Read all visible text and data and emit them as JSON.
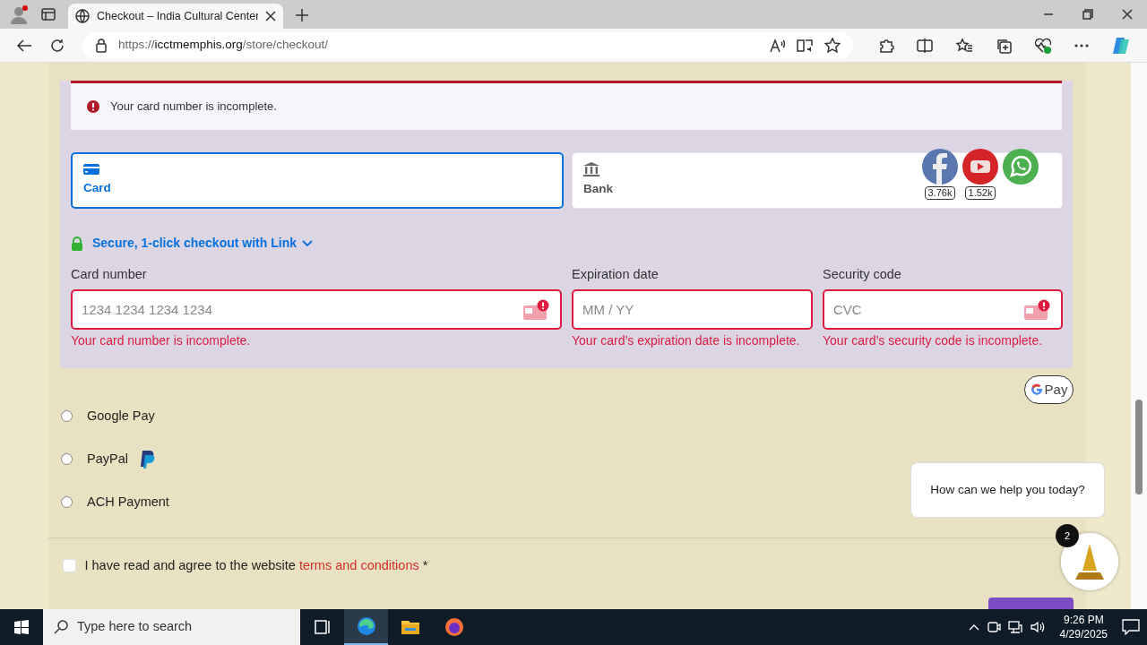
{
  "browser": {
    "tabs": [
      {
        "title": "Checkout – India Cultural Center",
        "selected": true
      }
    ],
    "url": {
      "scheme": "https://",
      "domain": "icctmemphis.org",
      "path": "/store/checkout/"
    }
  },
  "alert": {
    "text": "Your card number is incomplete."
  },
  "payment_tabs": [
    {
      "label": "Card",
      "kind": "card",
      "selected": true
    },
    {
      "label": "Bank",
      "kind": "bank",
      "selected": false
    }
  ],
  "social": [
    {
      "kind": "facebook",
      "count": "3.76k"
    },
    {
      "kind": "youtube",
      "count": "1.52k"
    },
    {
      "kind": "whatsapp"
    }
  ],
  "link_checkout": "Secure, 1-click checkout with Link",
  "fields": [
    {
      "label": "Card number",
      "placeholder": "1234 1234 1234 1234",
      "error": "Your card number is incomplete.",
      "kind": "card"
    },
    {
      "label": "Expiration date",
      "placeholder": "MM / YY",
      "error": "Your card’s expiration date is incomplete.",
      "kind": "expiry"
    },
    {
      "label": "Security code",
      "placeholder": "CVC",
      "error": "Your card’s security code is incomplete.",
      "kind": "cvc"
    }
  ],
  "payment_options": [
    {
      "label": "Google Pay",
      "kind": "googlepay",
      "selected": false,
      "badge": "Pay"
    },
    {
      "label": "PayPal",
      "kind": "paypal",
      "selected": false
    },
    {
      "label": "ACH Payment",
      "kind": "ach",
      "selected": false
    }
  ],
  "terms": {
    "text": "I have read and agree to the website",
    "link": "terms and conditions",
    "required": "*",
    "checked": false
  },
  "chat": {
    "message": "How can we help you today?",
    "badge": "2"
  },
  "taskbar": {
    "search_placeholder": "Type here to search",
    "time": "9:26 PM",
    "date": "4/29/2025"
  }
}
